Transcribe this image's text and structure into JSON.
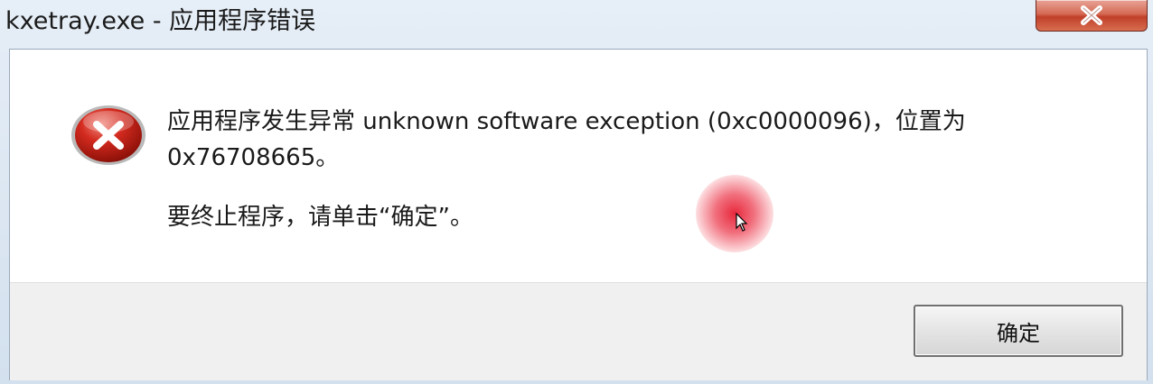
{
  "window": {
    "title": "kxetray.exe - 应用程序错误",
    "close_icon": "close-icon"
  },
  "dialog": {
    "icon": "error-icon",
    "message_line": "应用程序发生异常 unknown software exception (0xc0000096)，位置为 0x76708665。",
    "instruction": "要终止程序，请单击“确定”。",
    "ok_label": "确定"
  },
  "overlay": {
    "cursor_highlight_color": "#e8283c",
    "cursor_icon": "mouse-pointer-icon"
  }
}
